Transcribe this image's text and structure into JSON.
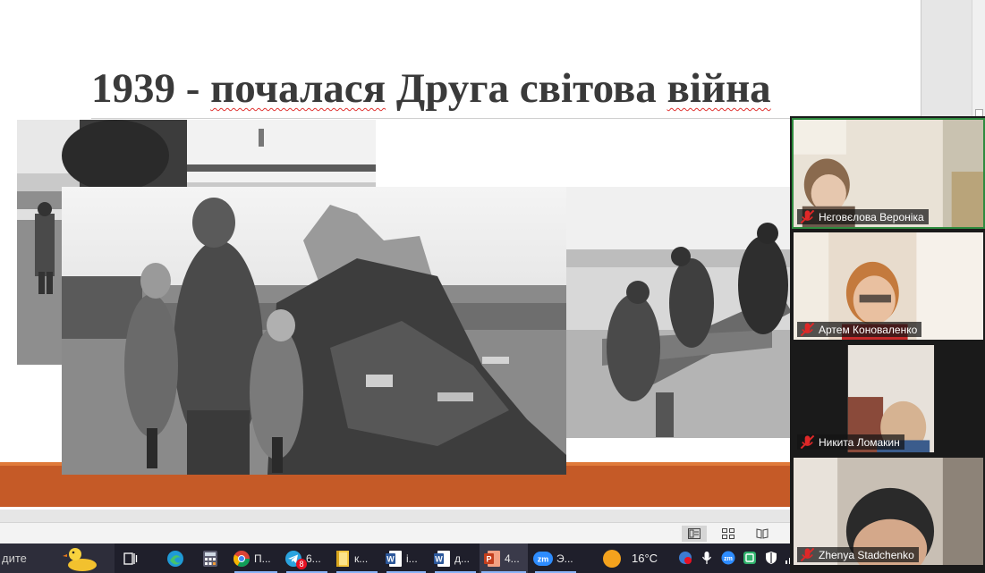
{
  "slide": {
    "title_year": "1939 - ",
    "title_word1": "почалася",
    "title_word2": " Друга світова ",
    "title_word3": "війна"
  },
  "status_bar": {
    "views": [
      "normal-view",
      "slide-sorter-view",
      "reading-view"
    ]
  },
  "taskbar": {
    "search_text": "дите",
    "items": [
      {
        "icon": "task-view-icon",
        "label": ""
      },
      {
        "icon": "edge-icon",
        "label": ""
      },
      {
        "icon": "calculator-icon",
        "label": ""
      },
      {
        "icon": "chrome-icon",
        "label": "П..."
      },
      {
        "icon": "telegram-icon",
        "label": "6...",
        "badge": "8"
      },
      {
        "icon": "file-explorer-icon",
        "label": "к..."
      },
      {
        "icon": "word-icon",
        "label": "і..."
      },
      {
        "icon": "word-icon",
        "label": "д..."
      },
      {
        "icon": "powerpoint-icon",
        "label": "4..."
      },
      {
        "icon": "zoom-icon",
        "label": "Э..."
      }
    ],
    "weather_temp": "16°C",
    "tray_icons": [
      "antivirus-icon",
      "microphone-icon",
      "zoom-tray-icon",
      "app-tray-icon",
      "shield-tray-icon",
      "network-icon"
    ]
  },
  "zoom": {
    "participants": [
      {
        "name": "Нєговєлова Вероніка",
        "muted": true,
        "active_speaker": true
      },
      {
        "name": "Артем Коноваленко",
        "muted": true,
        "active_speaker": false
      },
      {
        "name": "Никита Ломакин",
        "muted": true,
        "active_speaker": false
      },
      {
        "name": "Zhenya Stadchenko",
        "muted": true,
        "active_speaker": false
      }
    ]
  },
  "colors": {
    "slide_band": "#c55a27",
    "slide_title": "#3a3a3a",
    "taskbar": "#1f1f2b",
    "active_speaker_border": "#2e8b3e"
  }
}
